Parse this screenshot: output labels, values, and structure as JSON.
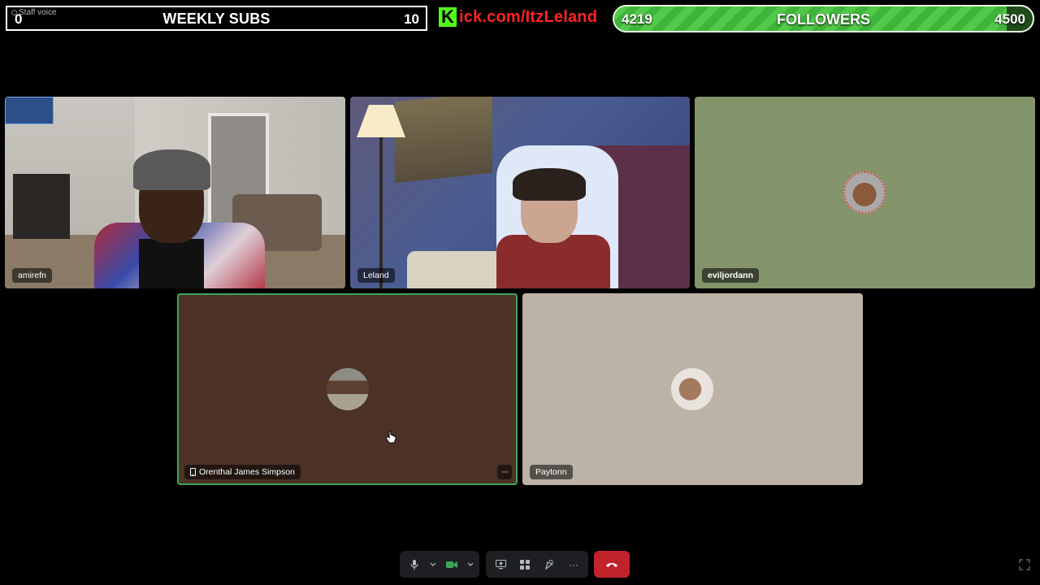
{
  "overlay": {
    "subs": {
      "staff_label": "Staff voice",
      "current": "0",
      "title": "WEEKLY SUBS",
      "goal": "10"
    },
    "kick": {
      "logo_letter": "K",
      "url_text": "ick.com/ItzLeland"
    },
    "followers": {
      "current": "4219",
      "title": "FOLLOWERS",
      "goal": "4500",
      "progress_fraction": 0.937
    }
  },
  "participants": [
    {
      "name": "amirefn",
      "type": "camera",
      "speaking": false
    },
    {
      "name": "Leland",
      "type": "camera",
      "speaking": false
    },
    {
      "name": "eviljordann",
      "type": "avatar",
      "speaking": false
    },
    {
      "name": "Orenthal James Simpson",
      "type": "avatar",
      "speaking": true,
      "mobile": true
    },
    {
      "name": "Paytonn",
      "type": "avatar",
      "speaking": false
    }
  ],
  "colors": {
    "speaking_ring": "#3ba55c",
    "hangup": "#c0232c",
    "kick_green": "#53fc18",
    "kick_text": "#ff2222",
    "tile_eviljordann": "#84946a",
    "tile_orenthal": "#4c3226",
    "tile_paytonn": "#bcb2a6"
  },
  "controls": {
    "icons": [
      "microphone-icon",
      "camera-icon",
      "screen-share-icon",
      "activities-icon",
      "soundboard-icon",
      "more-icon",
      "hang-up-icon",
      "fullscreen-icon"
    ],
    "more_glyph": "···"
  }
}
